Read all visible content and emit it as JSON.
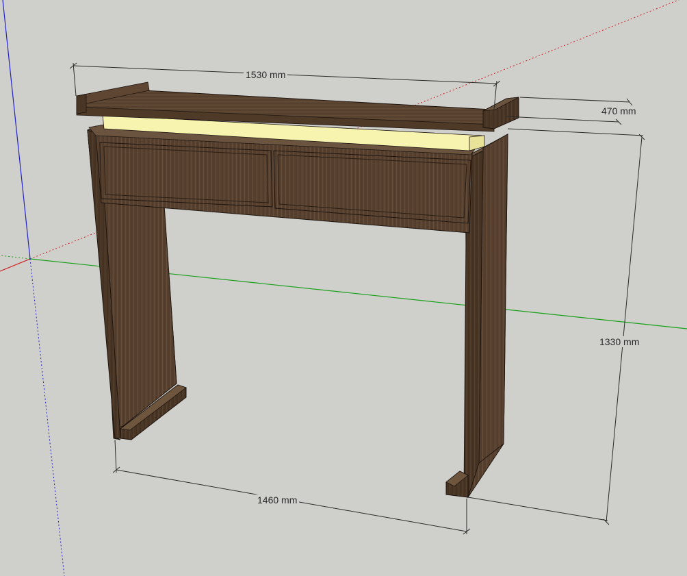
{
  "dimensions": {
    "top_width": "1530 mm",
    "depth": "470 mm",
    "height": "1330 mm",
    "bottom_width": "1460 mm"
  },
  "colors": {
    "background": "#cfcfcb",
    "axis_red": "#d02020",
    "axis_green": "#18a018",
    "axis_blue": "#2020d0",
    "wood_dark": "#4a3727",
    "wood_mid": "#5e4632",
    "wood_light": "#6e553e",
    "led_glow": "#f7f4b0"
  }
}
